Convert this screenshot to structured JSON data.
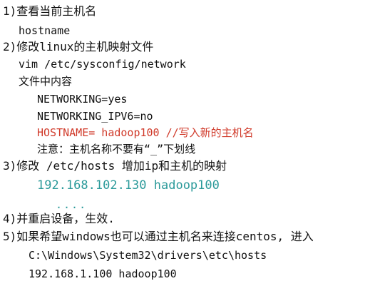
{
  "lines": {
    "step1_title": "1)查看当前主机名",
    "step1_cmd": "hostname",
    "step2_title": "2)修改linux的主机映射文件",
    "step2_cmd": "vim /etc/sysconfig/network",
    "step2_content_label": "文件中内容",
    "step2_line1": "NETWORKING=yes",
    "step2_line2": "NETWORKING_IPV6=no",
    "step2_line3": "HOSTNAME= hadoop100  //写入新的主机名",
    "step2_note": "注意：主机名称不要有“_”下划线",
    "step3_title": "3)修改 /etc/hosts 增加ip和主机的映射",
    "step3_mapping": "192.168.102.130  hadoop100",
    "step3_dots": "....",
    "step4_title": "4)并重启设备，生效.",
    "step5_title": "5)如果希望windows也可以通过主机名来连接centos, 进入",
    "step5_path": "C:\\Windows\\System32\\drivers\\etc\\hosts",
    "step5_mapping": "192.168.1.100 hadoop100"
  },
  "colors": {
    "text": "#111111",
    "highlight_red": "#d03a2a",
    "highlight_teal": "#2b9a9a",
    "background": "#ffffff"
  }
}
